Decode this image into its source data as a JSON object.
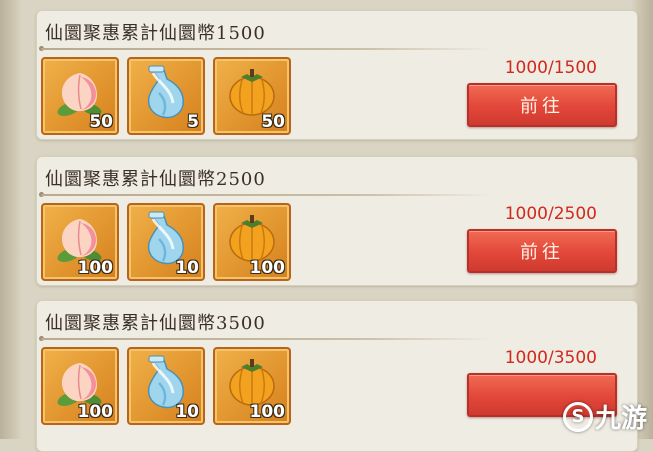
{
  "tasks": [
    {
      "title": "仙圜聚惠累計仙圜幣1500",
      "progress": "1000/1500",
      "button_label": "前往",
      "rewards": [
        {
          "icon": "peach-icon",
          "qty": "50"
        },
        {
          "icon": "water-bottle-icon",
          "qty": "5"
        },
        {
          "icon": "persimmon-icon",
          "qty": "50"
        }
      ]
    },
    {
      "title": "仙圜聚惠累計仙圜幣2500",
      "progress": "1000/2500",
      "button_label": "前往",
      "rewards": [
        {
          "icon": "peach-icon",
          "qty": "100"
        },
        {
          "icon": "water-bottle-icon",
          "qty": "10"
        },
        {
          "icon": "persimmon-icon",
          "qty": "100"
        }
      ]
    },
    {
      "title": "仙圜聚惠累計仙圜幣3500",
      "progress": "1000/3500",
      "button_label": "",
      "rewards": [
        {
          "icon": "peach-icon",
          "qty": "100"
        },
        {
          "icon": "water-bottle-icon",
          "qty": "10"
        },
        {
          "icon": "persimmon-icon",
          "qty": "100"
        }
      ]
    }
  ],
  "watermark": {
    "mark": "S",
    "text": "九游"
  },
  "colors": {
    "progress_text": "#d2281e",
    "button": "#e2473a",
    "item_frame": "#e2962f"
  }
}
